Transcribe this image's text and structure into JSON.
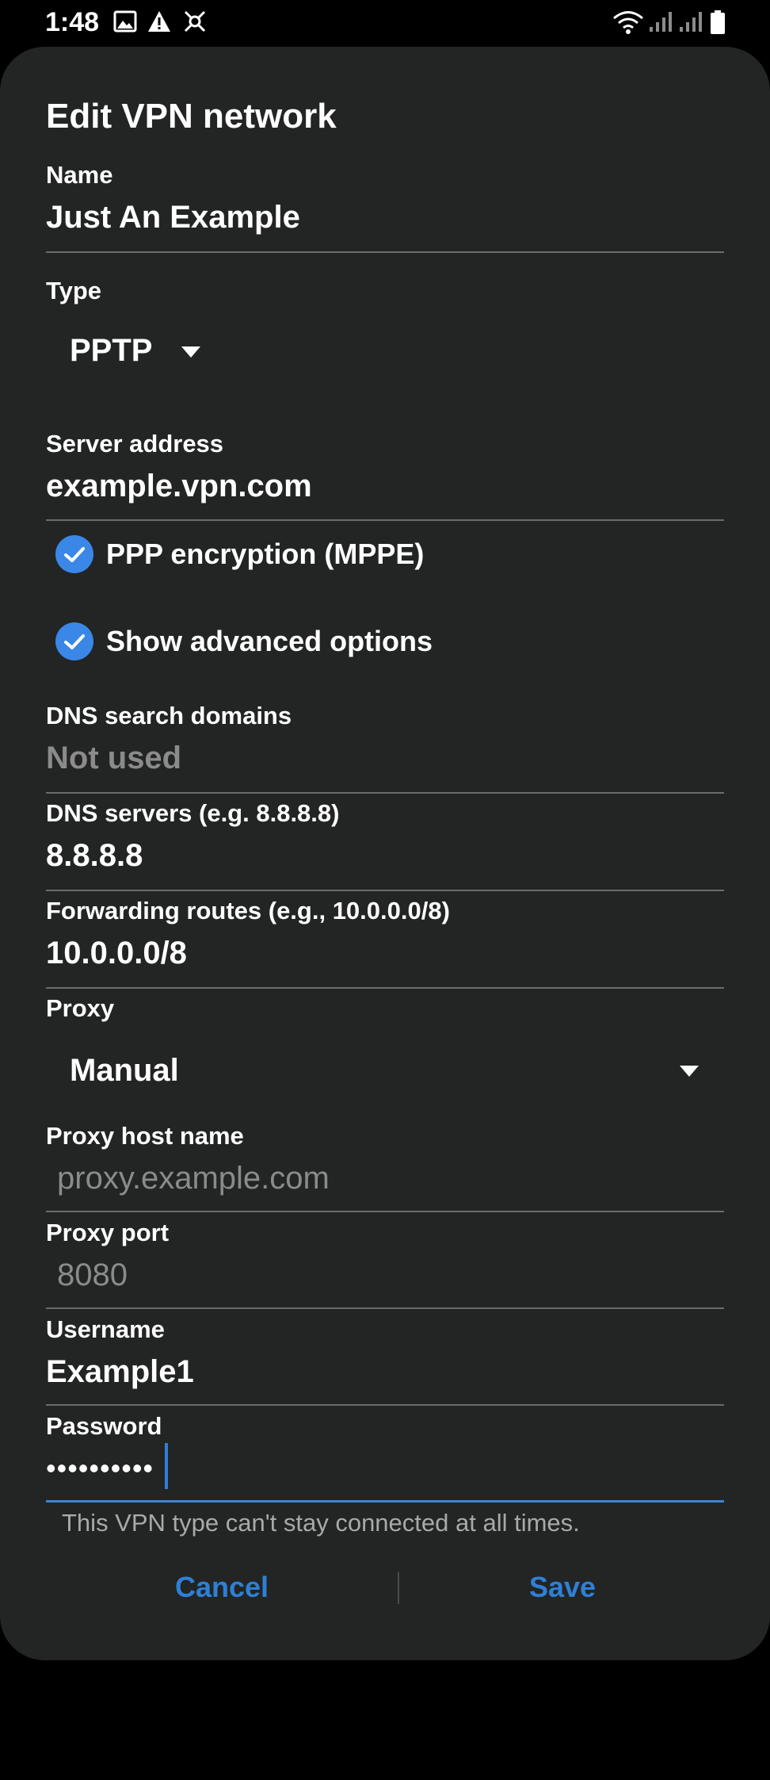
{
  "status_bar": {
    "time": "1:48",
    "icons_left": [
      "image-icon",
      "warning-icon",
      "app-icon"
    ],
    "icons_right": [
      "wifi-icon",
      "signal-icon",
      "signal-icon",
      "battery-icon"
    ]
  },
  "dialog": {
    "title": "Edit VPN network",
    "name": {
      "label": "Name",
      "value": "Just An Example"
    },
    "type": {
      "label": "Type",
      "value": "PPTP"
    },
    "server": {
      "label": "Server address",
      "value": "example.vpn.com"
    },
    "ppp_encryption": {
      "label": "PPP encryption (MPPE)",
      "checked": true
    },
    "advanced": {
      "label": "Show advanced options",
      "checked": true
    },
    "dns_search": {
      "label": "DNS search domains",
      "placeholder": "Not used"
    },
    "dns_servers": {
      "label": "DNS servers (e.g. 8.8.8.8)",
      "value": "8.8.8.8"
    },
    "forwarding": {
      "label": "Forwarding routes (e.g., 10.0.0.0/8)",
      "value": "10.0.0.0/8"
    },
    "proxy": {
      "label": "Proxy",
      "value": "Manual"
    },
    "proxy_host": {
      "label": "Proxy host name",
      "placeholder": "proxy.example.com"
    },
    "proxy_port": {
      "label": "Proxy port",
      "placeholder": "8080"
    },
    "username": {
      "label": "Username",
      "value": "Example1"
    },
    "password": {
      "label": "Password",
      "value": "••••••••••"
    },
    "warning": "This VPN type can't stay connected at all times.",
    "cancel_label": "Cancel",
    "save_label": "Save",
    "accent_color": "#2f7fd6",
    "background_color": "#222523"
  }
}
